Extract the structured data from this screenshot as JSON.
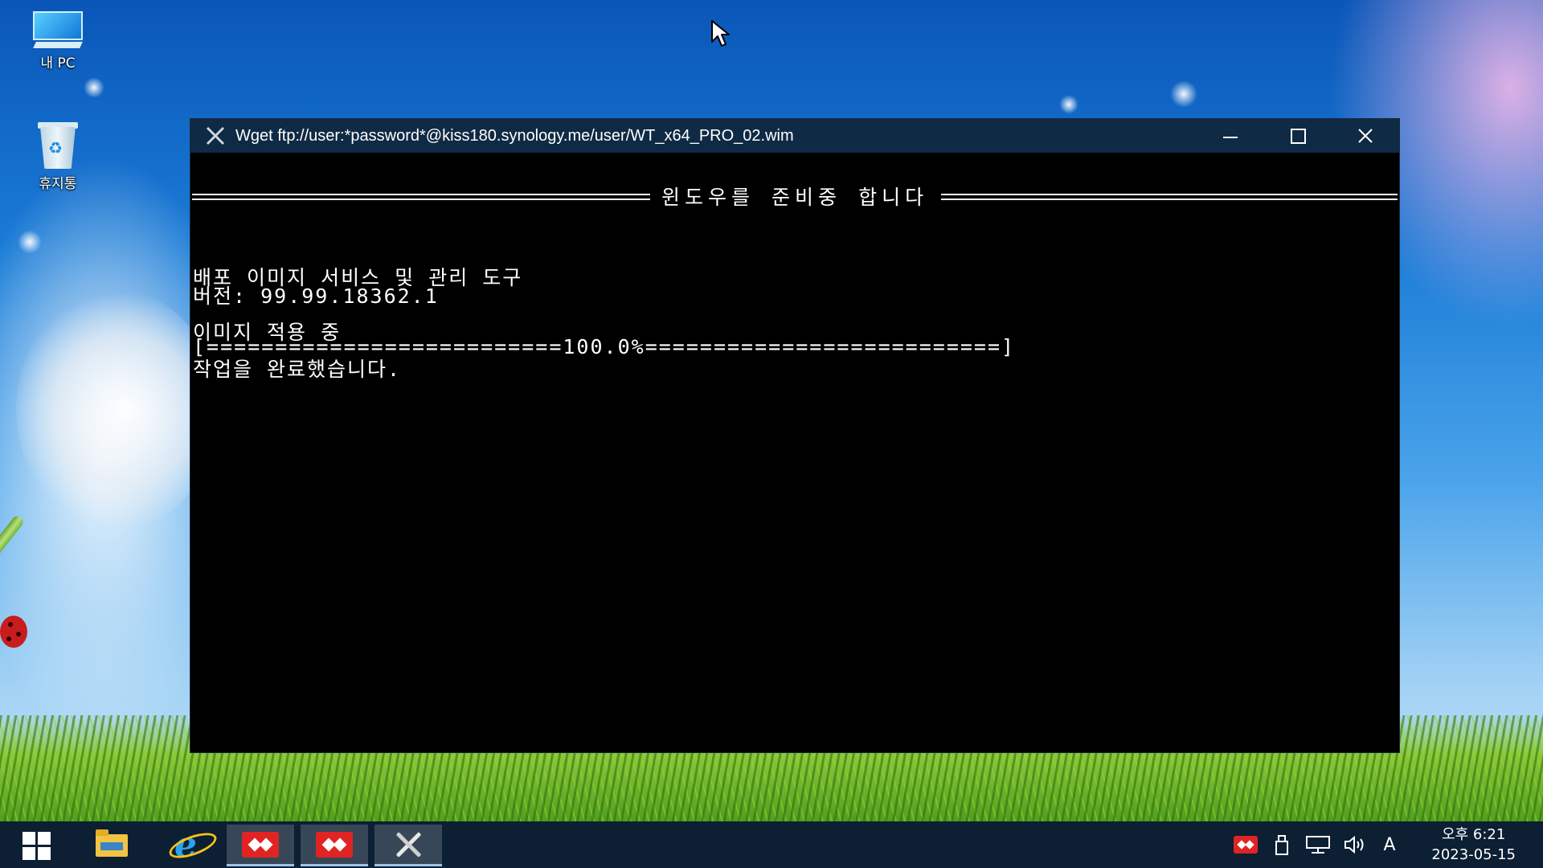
{
  "desktop": {
    "icons": [
      {
        "label": "내 PC",
        "icon": "this-pc-icon"
      },
      {
        "label": "휴지통",
        "icon": "recycle-bin-icon"
      }
    ]
  },
  "window": {
    "title": "Wget ftp://user:*password*@kiss180.synology.me/user/WT_x64_PRO_02.wim",
    "icon": "tools-icon",
    "controls": {
      "minimize": "minimize-icon",
      "maximize": "maximize-icon",
      "close": "close-icon"
    }
  },
  "console": {
    "banner": "윈도우를 준비중 합니다",
    "lines": [
      "배포 이미지 서비스 및 관리 도구",
      "버전: 99.99.18362.1",
      "이미지 적용 중",
      "[==========================100.0%==========================]",
      "작업을 완료했습니다."
    ],
    "progress_percent": 100.0
  },
  "taskbar": {
    "items": [
      {
        "icon": "windows-start-icon"
      },
      {
        "icon": "file-explorer-icon"
      },
      {
        "icon": "internet-explorer-icon"
      },
      {
        "icon": "red-app-icon",
        "active": true
      },
      {
        "icon": "red-app-icon",
        "active": true
      },
      {
        "icon": "tools-icon",
        "active": true
      }
    ],
    "tray": {
      "icons": [
        "red-app-tray-icon",
        "usb-drive-icon",
        "network-icon",
        "volume-icon"
      ],
      "ime": "A"
    },
    "clock": {
      "time": "오후 6:21",
      "date": "2023-05-15"
    }
  },
  "colors": {
    "titlebar": "#0f2a44",
    "taskbar": "#0c1f33",
    "console_bg": "#000000",
    "console_fg": "#ffffff"
  }
}
